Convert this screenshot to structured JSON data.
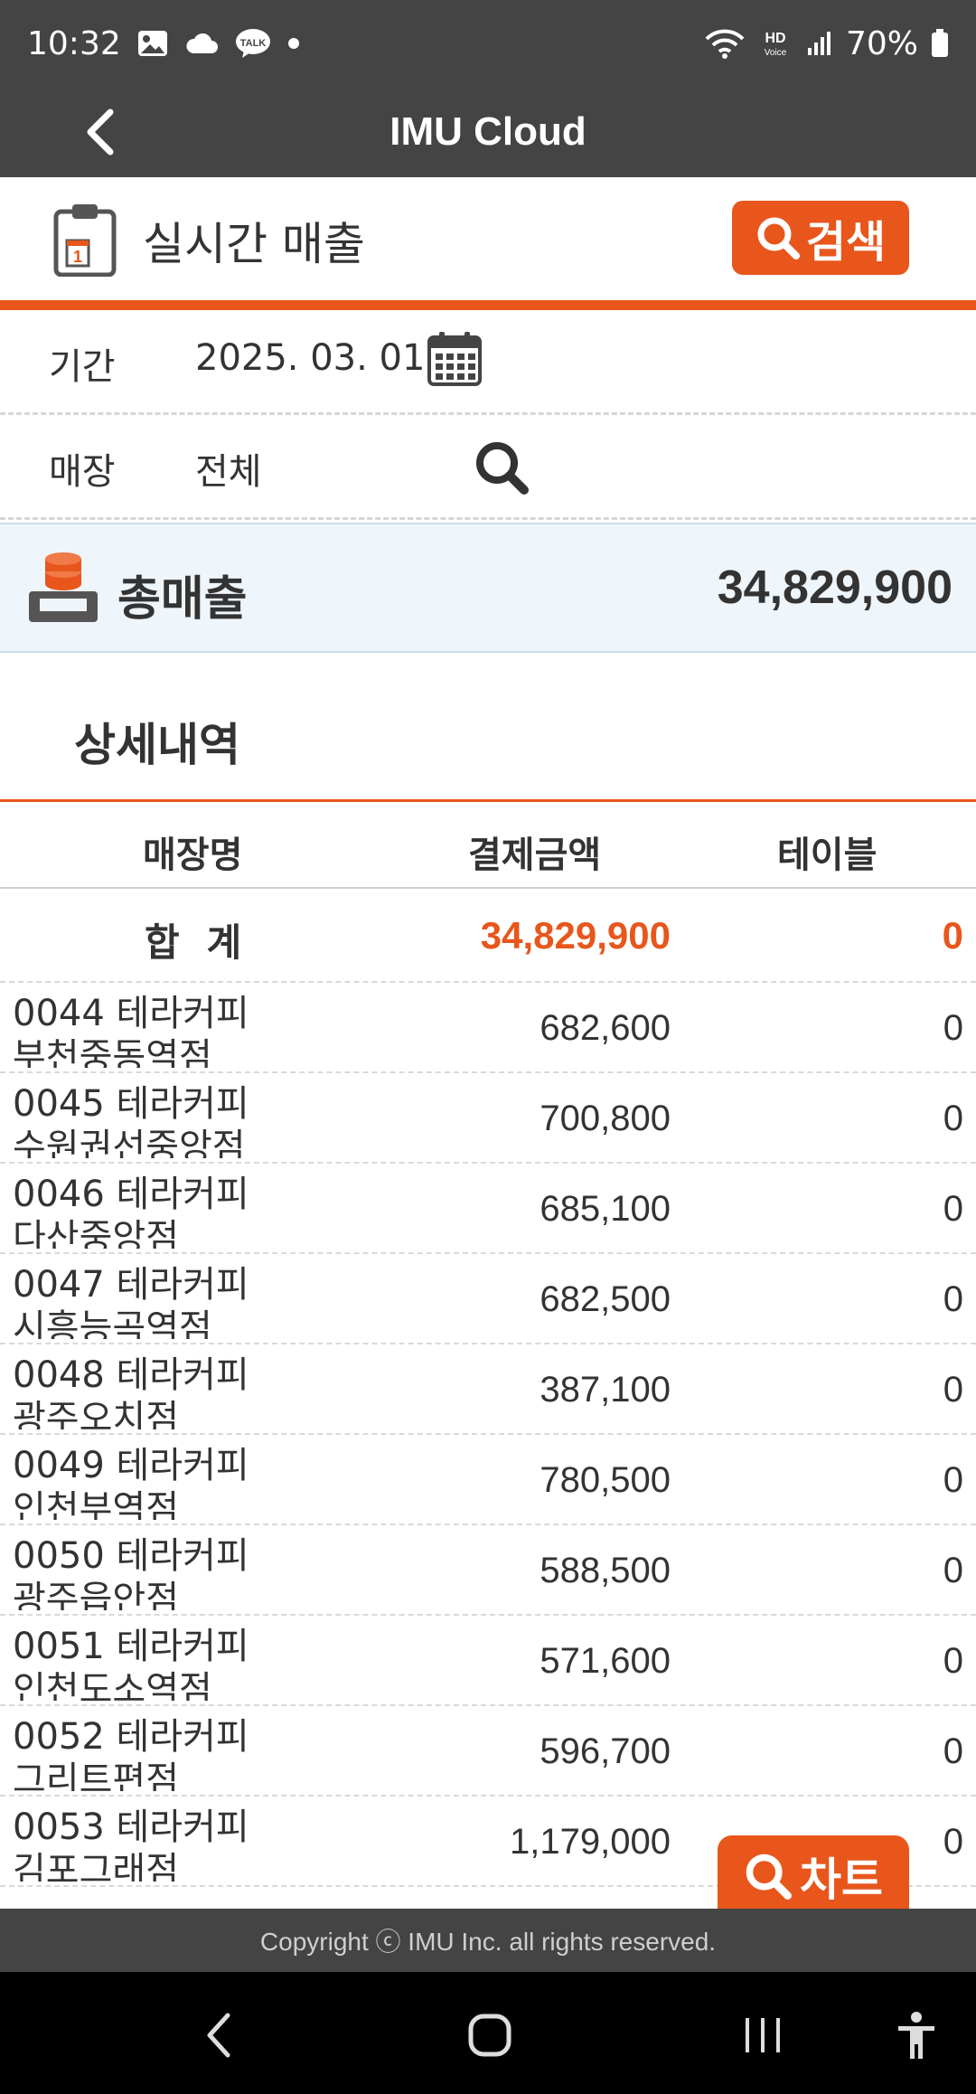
{
  "status_bar": {
    "time": "10:32",
    "battery": "70%",
    "hd_top": "HD",
    "hd_bottom": "Voice",
    "talk_badge": "TALK",
    "icons": [
      "gallery-icon",
      "cloud-icon",
      "talk-icon",
      "dot-icon",
      "wifi-icon",
      "signal-icon",
      "battery-icon"
    ]
  },
  "app_bar": {
    "title": "IMU Cloud"
  },
  "page": {
    "title": "실시간 매출",
    "clipboard_number": "1",
    "search_label": "검색"
  },
  "filters": {
    "period_label": "기간",
    "period_value": "2025. 03. 01",
    "store_label": "매장",
    "store_value": "전체"
  },
  "total": {
    "label": "총매출",
    "value": "34,829,900"
  },
  "details": {
    "title": "상세내역",
    "headers": {
      "store": "매장명",
      "amount": "결제금액",
      "table": "테이블"
    },
    "sum_row": {
      "label": "합계",
      "amount": "34,829,900",
      "table": "0"
    },
    "rows": [
      {
        "name": "0044 테라커피 부천중동역점",
        "amount": "682,600",
        "table": "0"
      },
      {
        "name": "0045 테라커피 수원권선중앙점",
        "amount": "700,800",
        "table": "0"
      },
      {
        "name": "0046 테라커피 다산중앙점",
        "amount": "685,100",
        "table": "0"
      },
      {
        "name": "0047 테라커피 시흥능곡역점",
        "amount": "682,500",
        "table": "0"
      },
      {
        "name": "0048 테라커피 광주오치점",
        "amount": "387,100",
        "table": "0"
      },
      {
        "name": "0049 테라커피 인천부역점",
        "amount": "780,500",
        "table": "0"
      },
      {
        "name": "0050 테라커피 광주읍안점",
        "amount": "588,500",
        "table": "0"
      },
      {
        "name": "0051 테라커피 인천도소역점",
        "amount": "571,600",
        "table": "0"
      },
      {
        "name": "0052 테라커피 그리트편점",
        "amount": "596,700",
        "table": "0"
      },
      {
        "name": "0053 테라커피 김포그래점",
        "amount": "1,179,000",
        "table": "0"
      }
    ]
  },
  "chart_button": {
    "label": "차트"
  },
  "footer": {
    "copyright": "Copyright ⓒ IMU Inc. all rights reserved."
  },
  "colors": {
    "accent": "#e8561c",
    "bar": "#444444",
    "total_bg": "#eef5fb"
  }
}
